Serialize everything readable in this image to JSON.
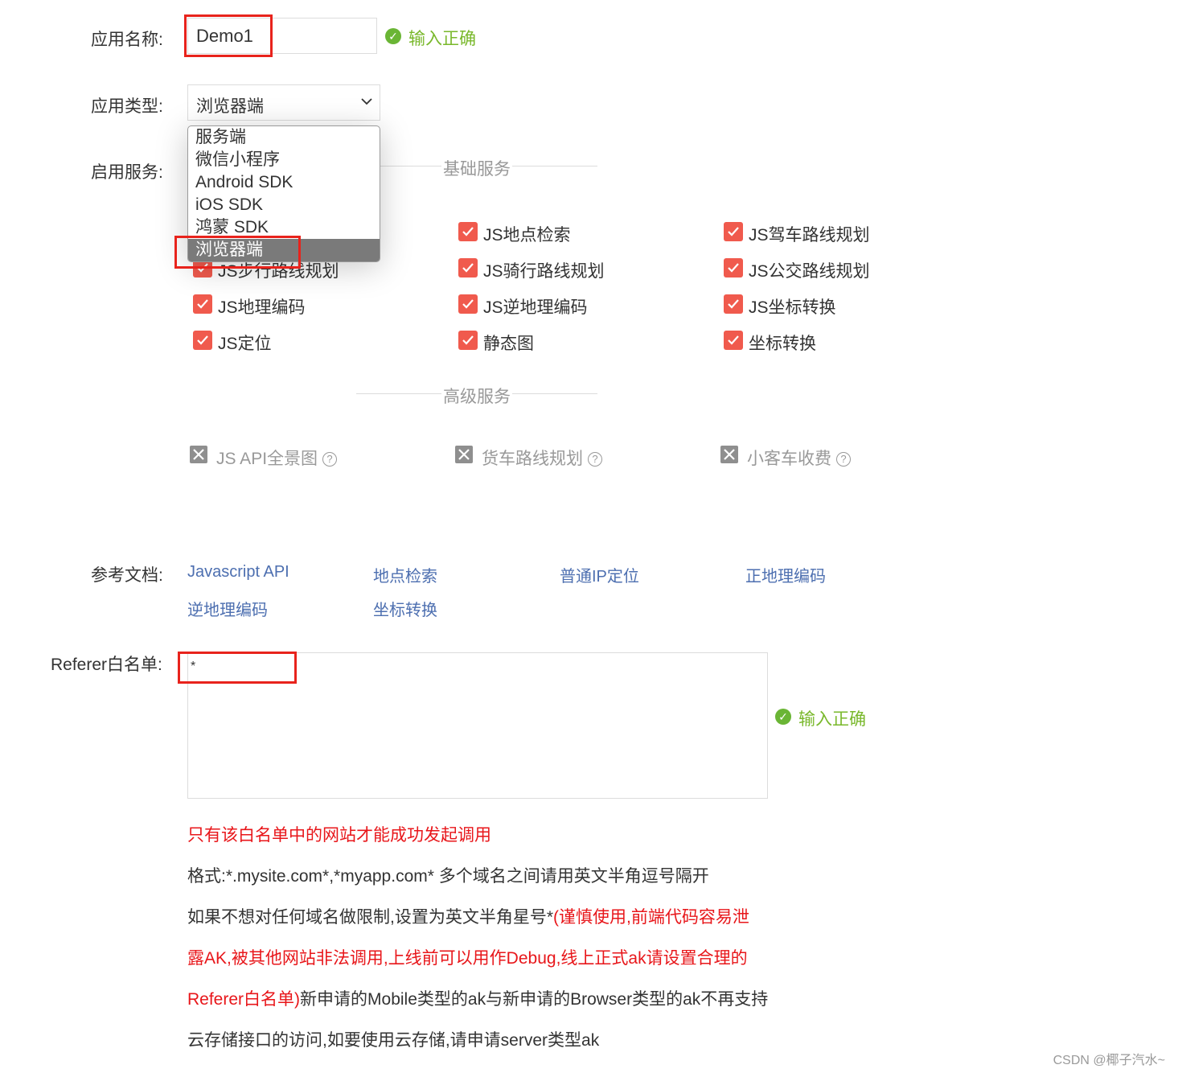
{
  "form": {
    "app_name_label": "应用名称:",
    "app_name_value": "Demo1",
    "app_name_status": "输入正确",
    "app_type_label": "应用类型:",
    "app_type_value": "浏览器端",
    "app_type_options": [
      "服务端",
      "微信小程序",
      "Android SDK",
      "iOS SDK",
      "鸿蒙 SDK",
      "浏览器端"
    ],
    "services_label": "启用服务:"
  },
  "basic_services": {
    "title": "基础服务",
    "items": [
      {
        "label": "JS地点检索",
        "checked": true
      },
      {
        "label": "JS驾车路线规划",
        "checked": true
      },
      {
        "label": "JS步行路线规划",
        "checked": true
      },
      {
        "label": "JS骑行路线规划",
        "checked": true
      },
      {
        "label": "JS公交路线规划",
        "checked": true
      },
      {
        "label": "JS地理编码",
        "checked": true
      },
      {
        "label": "JS逆地理编码",
        "checked": true
      },
      {
        "label": "JS坐标转换",
        "checked": true
      },
      {
        "label": "JS定位",
        "checked": true
      },
      {
        "label": "静态图",
        "checked": true
      },
      {
        "label": "坐标转换",
        "checked": true
      }
    ]
  },
  "advanced_services": {
    "title": "高级服务",
    "items": [
      {
        "label": "JS API全景图",
        "enabled": false
      },
      {
        "label": "货车路线规划",
        "enabled": false
      },
      {
        "label": "小客车收费",
        "enabled": false
      }
    ]
  },
  "docs": {
    "label": "参考文档:",
    "links": [
      "Javascript API",
      "地点检索",
      "普通IP定位",
      "正地理编码",
      "逆地理编码",
      "坐标转换"
    ]
  },
  "referer": {
    "label": "Referer白名单:",
    "value": "*",
    "status": "输入正确",
    "notes": {
      "line1": "只有该白名单中的网站才能成功发起调用",
      "line2": "格式:*.mysite.com*,*myapp.com* 多个域名之间请用英文半角逗号隔开",
      "line3_black": "如果不想对任何域名做限制,设置为英文半角星号*",
      "line3_red": "(谨慎使用,前端代码容易泄",
      "line4_red": "露AK,被其他网站非法调用,上线前可以用作Debug,线上正式ak请设置合理的",
      "line5_red": "Referer白名单)",
      "line5_black": "新申请的Mobile类型的ak与新申请的Browser类型的ak不再支持",
      "line6": "云存储接口的访问,如要使用云存储,请申请server类型ak"
    }
  },
  "watermark": "CSDN @椰子汽水~",
  "colors": {
    "checkbox": "#f05a4d",
    "success": "#79b82b",
    "link": "#4d6fb0",
    "warning": "#e8161a",
    "highlight": "#e8231c"
  }
}
